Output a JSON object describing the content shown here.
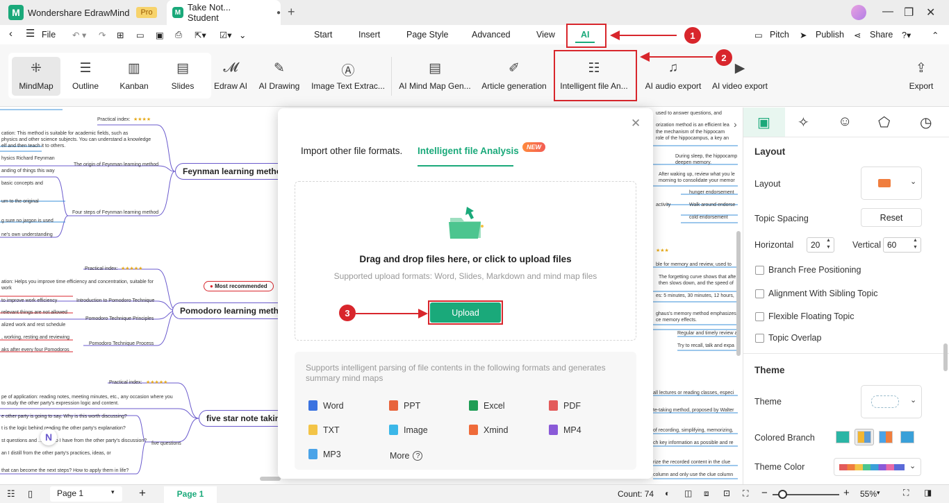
{
  "app": {
    "name": "Wondershare EdrawMind",
    "badge": "Pro",
    "doc_tab": "Take Not... Student"
  },
  "menu": {
    "file": "File",
    "tabs": [
      "Start",
      "Insert",
      "Page Style",
      "Advanced",
      "View",
      "AI"
    ],
    "right": [
      "Pitch",
      "Publish",
      "Share"
    ]
  },
  "ribbon": {
    "views": [
      "MindMap",
      "Outline",
      "Kanban",
      "Slides"
    ],
    "ai_tools": [
      "Edraw AI",
      "AI Drawing",
      "Image Text Extrac...",
      "AI Mind Map Gen...",
      "Article generation",
      "Intelligent file An...",
      "AI audio export",
      "AI video export"
    ],
    "export": "Export"
  },
  "annotations": {
    "n1": "1",
    "n2": "2",
    "n3": "3"
  },
  "canvas": {
    "topics": [
      "Feynman learning method",
      "Pomodoro learning method",
      "five star note taking"
    ],
    "most_recommended": "Most recommended",
    "left_notes": [
      "Practical index:",
      "cation: This method is suitable for academic fields, such as",
      "physics and other science subjects. You can understand a knowledge",
      "elf and then teach it to others.",
      "hysics Richard Feynman",
      "The origin of Feynman learning method",
      "anding of things this way",
      "basic concepts and",
      "um to the original",
      "Four steps of Feynman learning method",
      "g sure no jargon is used",
      "ne's own understanding",
      "Practical index:",
      "ation: Helps you improve time efficiency and concentration, suitable for",
      "work",
      "to improve work efficiency",
      "Introduction to Pomodoro Technique",
      "relevant things are not allowed",
      "Pomodoro Technique Principles",
      "alized work and rest schedule",
      ", working, resting and reviewing",
      "Pomodoro Technique Process",
      "aks after every four Pomodoros",
      "Practical index:",
      "pe of application: reading notes, meeting minutes, etc., any occasion where you",
      "to study the other party's expression logic and content.",
      "e other party is going to say. Why is this worth discussing?",
      "t is the logic behind reading the other party's explanation?",
      "st questions and ... ons do I have from the other party's discussion?",
      "five questions",
      "an I distill from the other party's practices, ideas, or",
      "that can become the next steps? How to apply them in life?"
    ],
    "right_notes": [
      "used to answer questions, and",
      "orization method is an efficient lea",
      "the mechanism of the hippocam",
      "role of the hippocampus, a key an",
      "During sleep, the hippocamp",
      "deepen memory.",
      "After waking up, review what you le",
      "morning to consolidate your memor",
      "hunger endorsement",
      "activity",
      "Walk around endorse",
      "cold endorsement",
      "ble for memory and review, used to",
      "The forgetting curve shows that afte",
      "then slows down, and the speed of",
      "es: 5 minutes, 30 minutes, 12 hours,",
      "ghaus's memory method emphasizes",
      "ce memory effects.",
      "Regular and timely review a",
      "Try to recall, talk and expa",
      "all lectures or reading classes, especi",
      "te-taking method, proposed by Walter",
      "of recording, simplifying, memorizing,",
      "ch key information as possible and re",
      "rize the recorded content in the clue",
      "column and only use the clue column"
    ]
  },
  "dialog": {
    "tab_import": "Import other file formats.",
    "tab_analysis": "Intelligent file Analysis",
    "new_badge": "NEW",
    "drop_title": "Drag and drop files here, or click to upload files",
    "drop_sub": "Supported upload formats: Word, Slides, Markdown and mind map files",
    "upload": "Upload",
    "support_text": "Supports intelligent parsing of file contents in the following formats and generates summary mind maps",
    "formats": [
      "Word",
      "PPT",
      "Excel",
      "PDF",
      "TXT",
      "Image",
      "Xmind",
      "MP4",
      "MP3"
    ],
    "more": "More"
  },
  "panel": {
    "layout_header": "Layout",
    "layout_label": "Layout",
    "topic_spacing": "Topic Spacing",
    "reset": "Reset",
    "horizontal_label": "Horizontal",
    "horizontal_value": "20",
    "vertical_label": "Vertical",
    "vertical_value": "60",
    "checks": [
      "Branch Free Positioning",
      "Alignment With Sibling Topic",
      "Flexible Floating Topic",
      "Topic Overlap"
    ],
    "theme_header": "Theme",
    "theme_label": "Theme",
    "colored_branch": "Colored Branch",
    "theme_color": "Theme Color"
  },
  "status": {
    "page_select": "Page 1",
    "page_tab": "Page 1",
    "count": "Count: 74",
    "zoom": "55%"
  },
  "colors": {
    "accent": "#1aa97a",
    "annotation": "#d8262c"
  }
}
